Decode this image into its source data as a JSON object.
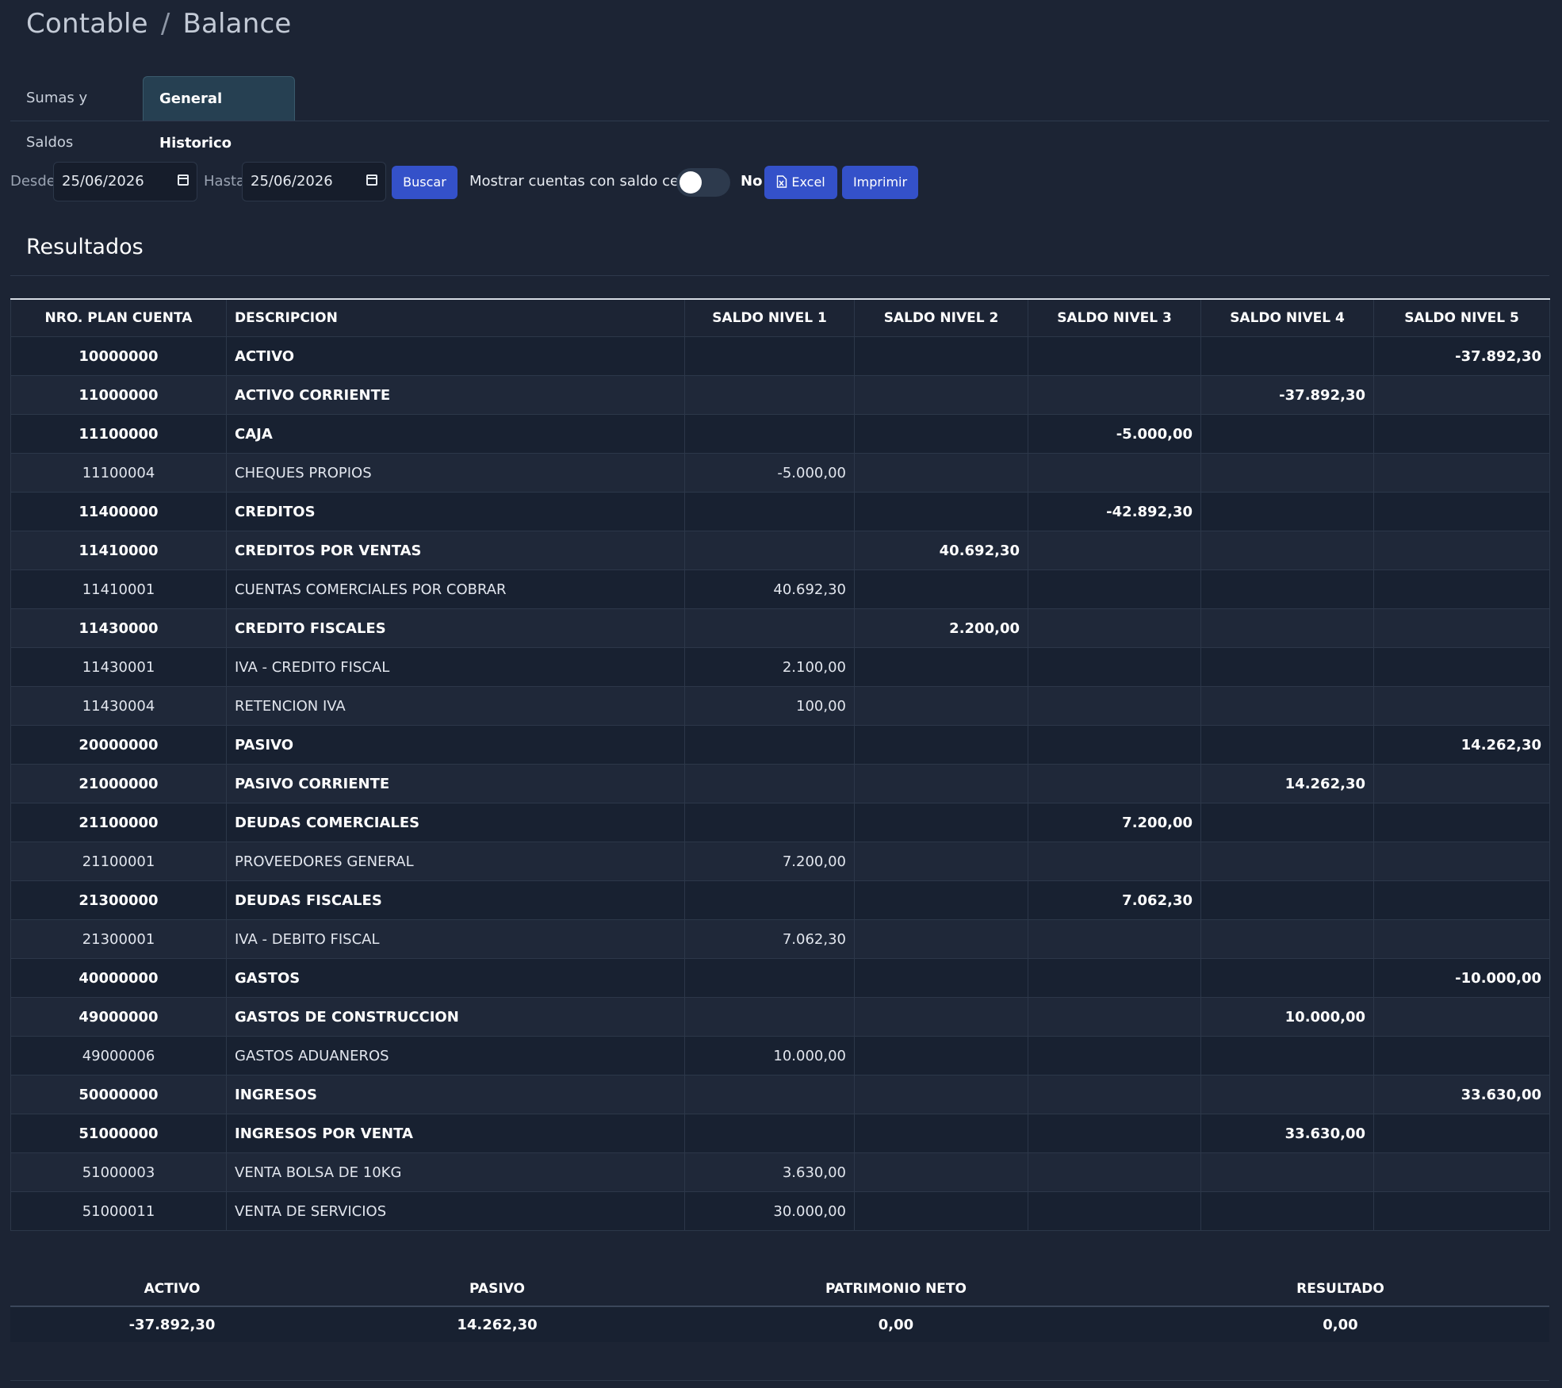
{
  "breadcrumb": {
    "section": "Contable",
    "separator": "/",
    "page": "Balance"
  },
  "tabs": [
    {
      "label": "Sumas y Saldos",
      "active": false
    },
    {
      "label": "General Historico",
      "active": true
    }
  ],
  "filters": {
    "desde_label": "Desde",
    "desde_value": "25/06/2026",
    "hasta_label": "Hasta",
    "hasta_value": "25/06/2026",
    "buscar_label": "Buscar",
    "zero_balance_label": "Mostrar cuentas con saldo cero",
    "zero_balance_state": "No",
    "excel_label": "Excel",
    "imprimir_label": "Imprimir"
  },
  "results_title": "Resultados",
  "table": {
    "headers": [
      "NRO. PLAN CUENTA",
      "DESCRIPCION",
      "SALDO NIVEL 1",
      "SALDO NIVEL 2",
      "SALDO NIVEL 3",
      "SALDO NIVEL 4",
      "SALDO NIVEL 5"
    ],
    "rows": [
      {
        "nro": "10000000",
        "desc": "ACTIVO",
        "level": 0,
        "bold": true,
        "n1": "",
        "n2": "",
        "n3": "",
        "n4": "",
        "n5": "-37.892,30"
      },
      {
        "nro": "11000000",
        "desc": "ACTIVO CORRIENTE",
        "level": 1,
        "bold": true,
        "n1": "",
        "n2": "",
        "n3": "",
        "n4": "-37.892,30",
        "n5": ""
      },
      {
        "nro": "11100000",
        "desc": "CAJA",
        "level": 2,
        "bold": true,
        "n1": "",
        "n2": "",
        "n3": "-5.000,00",
        "n4": "",
        "n5": ""
      },
      {
        "nro": "11100004",
        "desc": "CHEQUES PROPIOS",
        "level": 4,
        "bold": false,
        "n1": "-5.000,00",
        "n2": "",
        "n3": "",
        "n4": "",
        "n5": ""
      },
      {
        "nro": "11400000",
        "desc": "CREDITOS",
        "level": 2,
        "bold": true,
        "n1": "",
        "n2": "",
        "n3": "-42.892,30",
        "n4": "",
        "n5": ""
      },
      {
        "nro": "11410000",
        "desc": "CREDITOS POR VENTAS",
        "level": 3,
        "bold": true,
        "n1": "",
        "n2": "40.692,30",
        "n3": "",
        "n4": "",
        "n5": ""
      },
      {
        "nro": "11410001",
        "desc": "CUENTAS COMERCIALES POR COBRAR",
        "level": 4,
        "bold": false,
        "n1": "40.692,30",
        "n2": "",
        "n3": "",
        "n4": "",
        "n5": ""
      },
      {
        "nro": "11430000",
        "desc": "CREDITO FISCALES",
        "level": 3,
        "bold": true,
        "n1": "",
        "n2": "2.200,00",
        "n3": "",
        "n4": "",
        "n5": ""
      },
      {
        "nro": "11430001",
        "desc": "IVA - CREDITO FISCAL",
        "level": 4,
        "bold": false,
        "n1": "2.100,00",
        "n2": "",
        "n3": "",
        "n4": "",
        "n5": ""
      },
      {
        "nro": "11430004",
        "desc": "RETENCION IVA",
        "level": 4,
        "bold": false,
        "n1": "100,00",
        "n2": "",
        "n3": "",
        "n4": "",
        "n5": ""
      },
      {
        "nro": "20000000",
        "desc": "PASIVO",
        "level": 0,
        "bold": true,
        "n1": "",
        "n2": "",
        "n3": "",
        "n4": "",
        "n5": "14.262,30"
      },
      {
        "nro": "21000000",
        "desc": "PASIVO CORRIENTE",
        "level": 1,
        "bold": true,
        "n1": "",
        "n2": "",
        "n3": "",
        "n4": "14.262,30",
        "n5": ""
      },
      {
        "nro": "21100000",
        "desc": "DEUDAS COMERCIALES",
        "level": 2,
        "bold": true,
        "n1": "",
        "n2": "",
        "n3": "7.200,00",
        "n4": "",
        "n5": ""
      },
      {
        "nro": "21100001",
        "desc": "PROVEEDORES GENERAL",
        "level": 4,
        "bold": false,
        "n1": "7.200,00",
        "n2": "",
        "n3": "",
        "n4": "",
        "n5": ""
      },
      {
        "nro": "21300000",
        "desc": "DEUDAS FISCALES",
        "level": 2,
        "bold": true,
        "n1": "",
        "n2": "",
        "n3": "7.062,30",
        "n4": "",
        "n5": ""
      },
      {
        "nro": "21300001",
        "desc": "IVA - DEBITO FISCAL",
        "level": 4,
        "bold": false,
        "n1": "7.062,30",
        "n2": "",
        "n3": "",
        "n4": "",
        "n5": ""
      },
      {
        "nro": "40000000",
        "desc": "GASTOS",
        "level": 0,
        "bold": true,
        "n1": "",
        "n2": "",
        "n3": "",
        "n4": "",
        "n5": "-10.000,00"
      },
      {
        "nro": "49000000",
        "desc": "GASTOS DE CONSTRUCCION",
        "level": 1,
        "bold": true,
        "n1": "",
        "n2": "",
        "n3": "",
        "n4": "10.000,00",
        "n5": ""
      },
      {
        "nro": "49000006",
        "desc": "GASTOS ADUANEROS",
        "level": 4,
        "bold": false,
        "n1": "10.000,00",
        "n2": "",
        "n3": "",
        "n4": "",
        "n5": ""
      },
      {
        "nro": "50000000",
        "desc": "INGRESOS",
        "level": 0,
        "bold": true,
        "n1": "",
        "n2": "",
        "n3": "",
        "n4": "",
        "n5": "33.630,00"
      },
      {
        "nro": "51000000",
        "desc": "INGRESOS POR VENTA",
        "level": 1,
        "bold": true,
        "n1": "",
        "n2": "",
        "n3": "",
        "n4": "33.630,00",
        "n5": ""
      },
      {
        "nro": "51000003",
        "desc": "VENTA BOLSA DE 10KG",
        "level": 4,
        "bold": false,
        "n1": "3.630,00",
        "n2": "",
        "n3": "",
        "n4": "",
        "n5": ""
      },
      {
        "nro": "51000011",
        "desc": "VENTA DE SERVICIOS",
        "level": 4,
        "bold": false,
        "n1": "30.000,00",
        "n2": "",
        "n3": "",
        "n4": "",
        "n5": ""
      }
    ]
  },
  "summary": {
    "headers": [
      "ACTIVO",
      "PASIVO",
      "PATRIMONIO NETO",
      "RESULTADO"
    ],
    "values": [
      "-37.892,30",
      "14.262,30",
      "0,00",
      "0,00"
    ]
  },
  "colors": {
    "background": "#1c2434",
    "primary_button": "#3451c9",
    "active_tab": "#264052"
  }
}
